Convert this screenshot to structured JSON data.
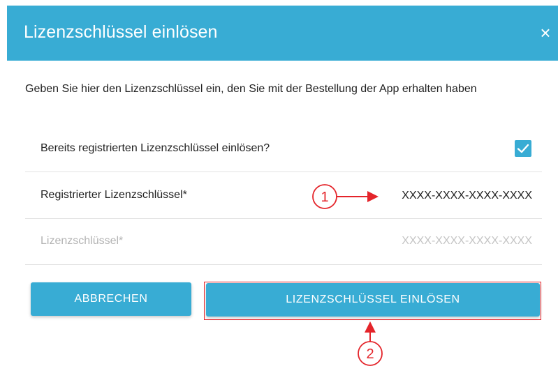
{
  "dialog": {
    "title": "Lizenzschlüssel einlösen",
    "close_symbol": "×",
    "intro": "Geben Sie hier den Lizenzschlüssel ein, den Sie mit der Bestellung der App erhalten haben"
  },
  "form": {
    "registered_toggle": {
      "label": "Bereits registrierten Lizenzschlüssel einlösen?",
      "checked": true
    },
    "registered_key": {
      "label": "Registrierter Lizenzschlüssel*",
      "value": "XXXX-XXXX-XXXX-XXXX"
    },
    "license_key": {
      "label": "Lizenzschlüssel*",
      "placeholder": "XXXX-XXXX-XXXX-XXXX"
    }
  },
  "buttons": {
    "cancel": "ABBRECHEN",
    "redeem": "LIZENZSCHLÜSSEL EINLÖSEN"
  },
  "annotations": {
    "step_1": "1",
    "step_2": "2"
  },
  "colors": {
    "accent": "#38acd4",
    "annotation": "#e4242a",
    "placeholder": "#c4c4c4"
  },
  "icons": {
    "close": "close-icon",
    "checkbox": "checkmark-icon"
  }
}
